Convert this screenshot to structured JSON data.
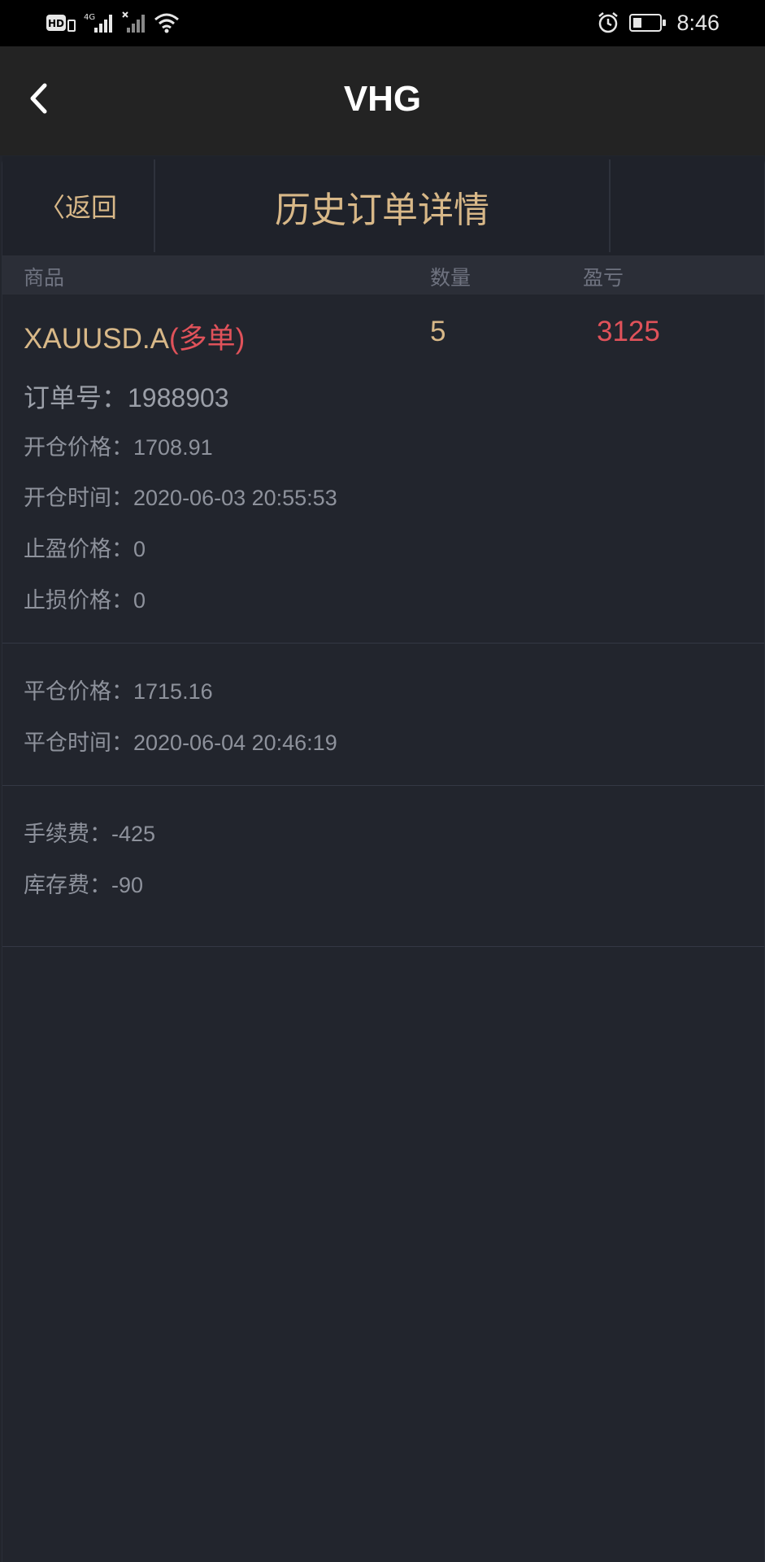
{
  "status_bar": {
    "time": "8:46",
    "hd_label": "HD",
    "network_label": "4G",
    "icons": [
      "hd-icon",
      "signal-icon",
      "signal-no-sim-icon",
      "wifi-icon",
      "alarm-icon",
      "battery-icon"
    ]
  },
  "app_bar": {
    "title": "VHG",
    "back_icon": "chevron-left-icon"
  },
  "sub_header": {
    "back_label": "〈返回",
    "title": "历史订单详情"
  },
  "columns": {
    "product": "商品",
    "quantity": "数量",
    "profit": "盈亏"
  },
  "order": {
    "symbol": "XAUUSD.A",
    "direction": "(多单)",
    "quantity": "5",
    "profit": "3125",
    "order_no": "订单号：1988903",
    "open_price": "开仓价格：1708.91",
    "open_time": "开仓时间：2020-06-03 20:55:53",
    "take_profit": "止盈价格：0",
    "stop_loss": "止损价格：0",
    "close_price": "平仓价格：1715.16",
    "close_time": "平仓时间：2020-06-04 20:46:19",
    "commission": "手续费：-425",
    "swap": "库存费：-90"
  },
  "colors": {
    "accent_gold": "#d8b888",
    "loss_red": "#e0525a",
    "background": "#22252d"
  }
}
